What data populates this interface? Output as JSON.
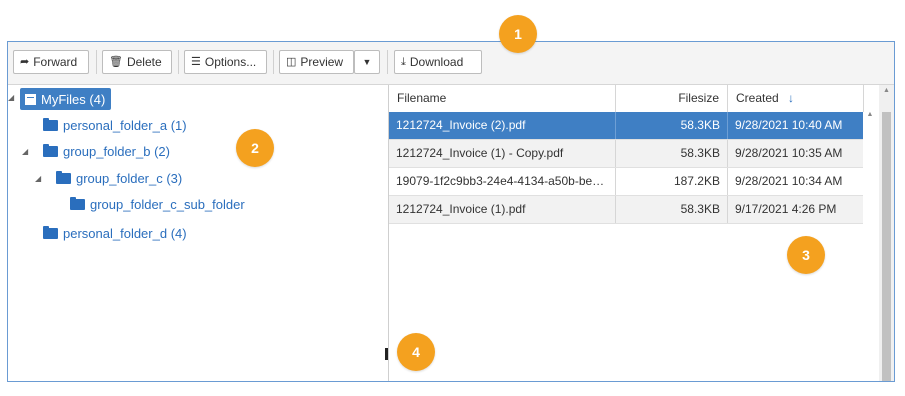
{
  "toolbar": {
    "forward": "Forward",
    "delete": "Delete",
    "options": "Options...",
    "preview": "Preview",
    "download": "Download"
  },
  "tree": {
    "root": "MyFiles (4)",
    "items": [
      {
        "label": "personal_folder_a (1)"
      },
      {
        "label": "group_folder_b (2)"
      },
      {
        "label": "group_folder_c (3)"
      },
      {
        "label": "group_folder_c_sub_folder"
      },
      {
        "label": "personal_folder_d (4)"
      }
    ]
  },
  "grid": {
    "headers": {
      "filename": "Filename",
      "filesize": "Filesize",
      "created": "Created"
    },
    "sort_indicator": "↓",
    "rows": [
      {
        "filename": "1212724_Invoice (2).pdf",
        "filesize": "58.3KB",
        "created": "9/28/2021 10:40 AM"
      },
      {
        "filename": "1212724_Invoice (1) - Copy.pdf",
        "filesize": "58.3KB",
        "created": "9/28/2021 10:35 AM"
      },
      {
        "filename": "19079-1f2c9bb3-24e4-4134-a50b-beb...",
        "filesize": "187.2KB",
        "created": "9/28/2021 10:34 AM"
      },
      {
        "filename": "1212724_Invoice (1).pdf",
        "filesize": "58.3KB",
        "created": "9/17/2021 4:26 PM"
      }
    ]
  },
  "callouts": [
    "1",
    "2",
    "3",
    "4"
  ],
  "colors": {
    "accent": "#3f7fc4",
    "callout": "#f4a11f",
    "link": "#2a6ebd"
  }
}
